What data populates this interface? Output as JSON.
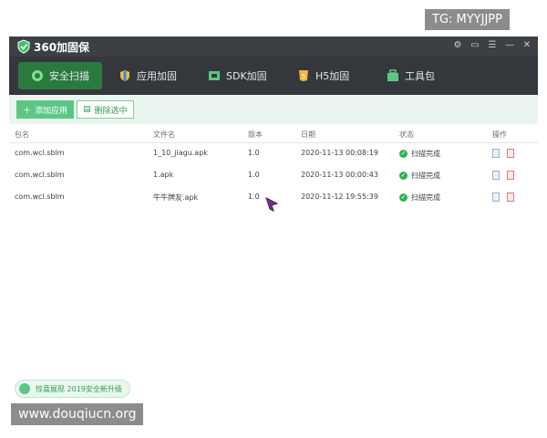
{
  "watermarks": {
    "tg": "TG: MYYJJPP",
    "url": "www.douqiucn.org"
  },
  "app": {
    "title": "360加固保"
  },
  "window_controls": [
    "settings-icon",
    "message-icon",
    "menu-icon",
    "minimize-icon",
    "close-icon"
  ],
  "tabs": [
    {
      "label": "安全扫描",
      "icon": "scan-icon",
      "active": true
    },
    {
      "label": "应用加固",
      "icon": "shield-icon",
      "active": false
    },
    {
      "label": "SDK加固",
      "icon": "sdk-icon",
      "active": false
    },
    {
      "label": "H5加固",
      "icon": "h5-icon",
      "active": false
    },
    {
      "label": "工具包",
      "icon": "toolbox-icon",
      "active": false
    }
  ],
  "toolbar": {
    "add_label": "添加应用",
    "delete_label": "删除选中"
  },
  "table": {
    "headers": [
      "包名",
      "文件名",
      "版本",
      "日期",
      "状态",
      "操作"
    ],
    "rows": [
      {
        "pkg": "com.wcl.sblm",
        "file": "1_10_jiagu.apk",
        "version": "1.0",
        "date": "2020-11-13 00:08:19",
        "status": "扫描完成"
      },
      {
        "pkg": "com.wcl.sblm",
        "file": "1.apk",
        "version": "1.0",
        "date": "2020-11-13 00:00:43",
        "status": "扫描完成"
      },
      {
        "pkg": "com.wcl.sblm",
        "file": "牛牛牌友.apk",
        "version": "1.0",
        "date": "2020-11-12 19:55:39",
        "status": "扫描完成"
      }
    ]
  },
  "footer": {
    "upgrade": "惊喜展现 2019安全新升级"
  },
  "colors": {
    "titlebar": "#3c4045",
    "tabbar": "#34383c",
    "accent": "#2e9e52",
    "active_tab": "#2b7a3d"
  }
}
